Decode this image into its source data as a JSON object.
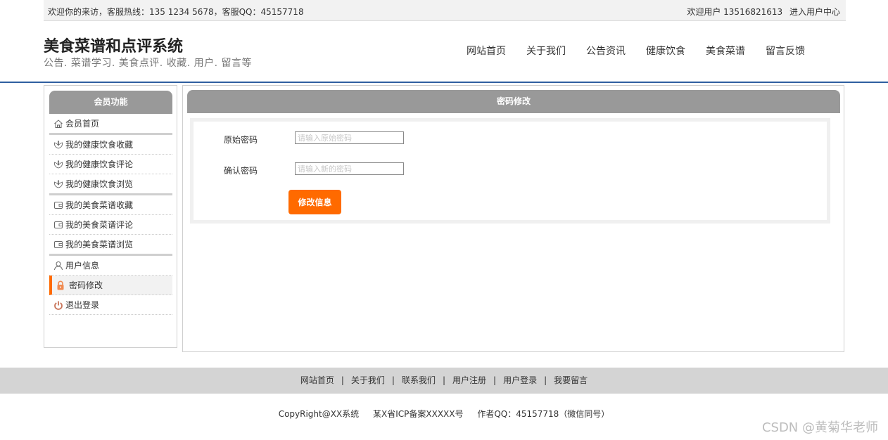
{
  "topbar": {
    "welcome_text": "欢迎你的来访，客服热线：135 1234 5678，客服QQ：45157718",
    "user_greeting": "欢迎用户 13516821613",
    "user_center_link": "进入用户中心"
  },
  "header": {
    "title": "美食菜谱和点评系统",
    "subtitle": "公告. 菜谱学习. 美食点评. 收藏. 用户. 留言等"
  },
  "nav": {
    "items": [
      "网站首页",
      "关于我们",
      "公告资讯",
      "健康饮食",
      "美食菜谱",
      "留言反馈"
    ]
  },
  "sidebar": {
    "title": "会员功能",
    "items": [
      {
        "label": "会员首页",
        "icon": "home-icon"
      },
      {
        "label": "我的健康饮食收藏",
        "icon": "flower-icon"
      },
      {
        "label": "我的健康饮食评论",
        "icon": "flower-icon"
      },
      {
        "label": "我的健康饮食浏览",
        "icon": "flower-icon"
      },
      {
        "label": "我的美食菜谱收藏",
        "icon": "wallet-icon"
      },
      {
        "label": "我的美食菜谱评论",
        "icon": "wallet-icon"
      },
      {
        "label": "我的美食菜谱浏览",
        "icon": "wallet-icon"
      },
      {
        "label": "用户信息",
        "icon": "user-icon"
      },
      {
        "label": "密码修改",
        "icon": "lock-icon"
      },
      {
        "label": "退出登录",
        "icon": "power-icon"
      }
    ]
  },
  "main": {
    "title": "密码修改",
    "form": {
      "original_label": "原始密码",
      "original_placeholder": "请输入原始密码",
      "original_value": "",
      "confirm_label": "确认密码",
      "confirm_placeholder": "请输入新的密码",
      "confirm_value": "",
      "submit_label": "修改信息"
    }
  },
  "footer": {
    "links": [
      "网站首页",
      "关于我们",
      "联系我们",
      "用户注册",
      "用户登录",
      "我要留言"
    ],
    "separator": "|",
    "copyright": "CopyRight@XX系统",
    "icp": "某X省ICP备案XXXXX号",
    "author": "作者QQ：45157718（微信同号）"
  },
  "watermark": "CSDN @黄菊华老师",
  "colors": {
    "accent": "#ff6a00",
    "header_border": "#2f5fa0",
    "panel_head": "#999999",
    "footer_bg": "#d4d4d4"
  }
}
